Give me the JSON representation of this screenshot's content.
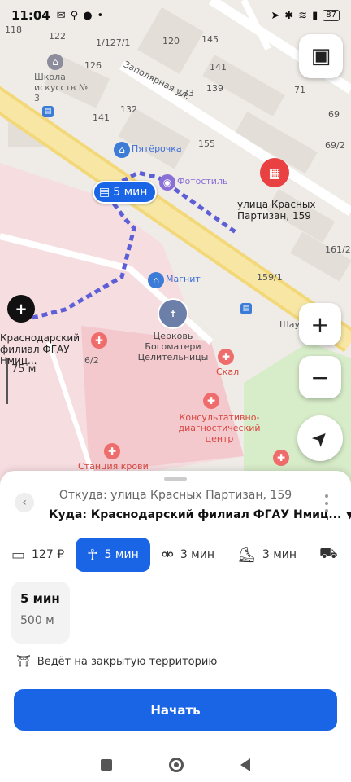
{
  "status_bar": {
    "time": "11:04",
    "battery": "87"
  },
  "map": {
    "house_numbers": [
      "118",
      "122",
      "1/127/1",
      "120",
      "145",
      "126",
      "141",
      "139",
      "133",
      "141",
      "132",
      "155",
      "71",
      "69",
      "69/2",
      "161/2",
      "159/1",
      "6/2"
    ],
    "street_labels": {
      "zapolyarnaya": "Заполярная ул.",
      "shau": "Шау"
    },
    "pois": {
      "school": "Школа искусств № 3",
      "pyaterochka": "Пятёрочка",
      "fotostil": "Фотостиль",
      "magnit": "Магнит",
      "church": "Церковь Богоматери Целительницы",
      "skal": "Скал",
      "consult": "Консультативно-диагностический центр",
      "blood": "Станция крови"
    },
    "route_time": "5 мин",
    "destination_label": "улица Красных Партизан, 159",
    "origin_label": "Краснодарский филиал ФГАУ Нмиц...",
    "distance_badge": "75 м"
  },
  "sheet": {
    "from": "Откуда: улица Красных Партизан, 159",
    "to": "Куда: Краснодарский филиал ФГАУ Нмиц...",
    "modes": [
      {
        "icon": "car-icon",
        "label": "127 ₽",
        "active": false
      },
      {
        "icon": "pedestrian-icon",
        "label": "5 мин",
        "active": true
      },
      {
        "icon": "bicycle-icon",
        "label": "3 мин",
        "active": false
      },
      {
        "icon": "scooter-icon",
        "label": "3 мин",
        "active": false
      },
      {
        "icon": "taxi-icon",
        "label": "",
        "active": false
      }
    ],
    "route_card": {
      "time": "5 мин",
      "distance": "500 м"
    },
    "warning": "Ведёт на закрытую территорию",
    "start_label": "Начать"
  },
  "colors": {
    "accent": "#1a64e6",
    "pin_red": "#e94141",
    "route_dots": "#5d5fd6"
  }
}
